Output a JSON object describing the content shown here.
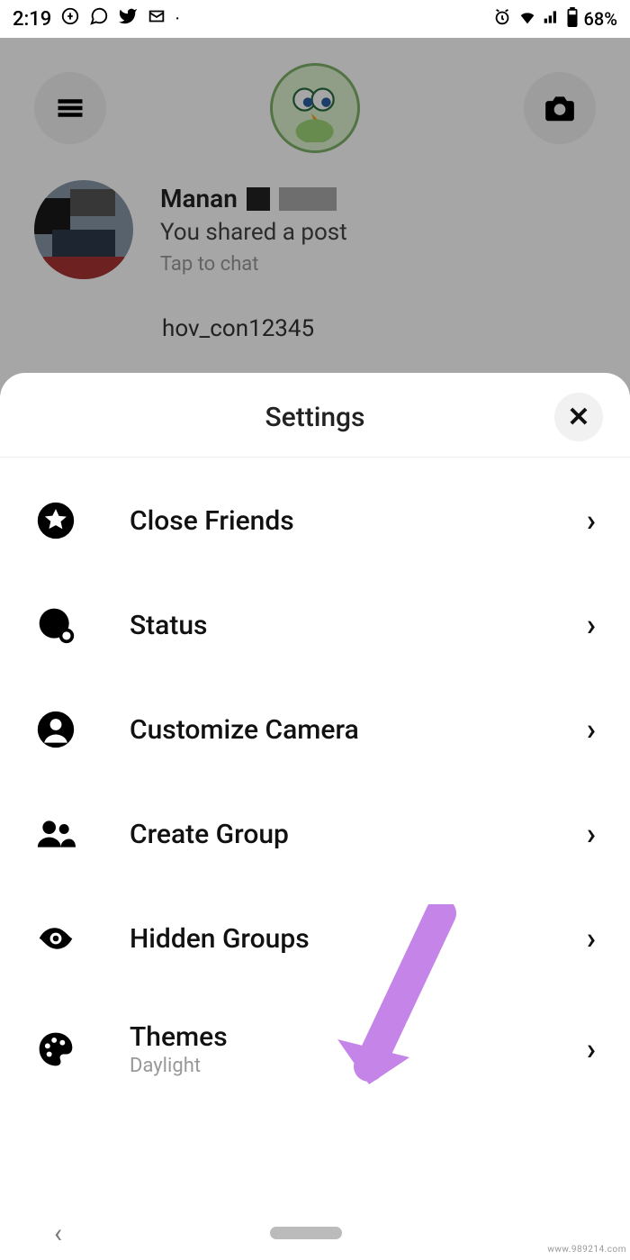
{
  "status": {
    "time": "2:19",
    "battery_percent": "68%"
  },
  "chat": {
    "name": "Manan",
    "subtitle": "You shared a post",
    "tap_hint": "Tap to chat",
    "next_row_name": "hov_con12345"
  },
  "sheet": {
    "title": "Settings",
    "items": [
      {
        "icon": "star-circle-icon",
        "label": "Close Friends",
        "sub": ""
      },
      {
        "icon": "status-icon",
        "label": "Status",
        "sub": ""
      },
      {
        "icon": "person-circle-icon",
        "label": "Customize Camera",
        "sub": ""
      },
      {
        "icon": "group-icon",
        "label": "Create Group",
        "sub": ""
      },
      {
        "icon": "eye-icon",
        "label": "Hidden Groups",
        "sub": ""
      },
      {
        "icon": "palette-icon",
        "label": "Themes",
        "sub": "Daylight"
      }
    ]
  },
  "watermark": "www.989214.com"
}
